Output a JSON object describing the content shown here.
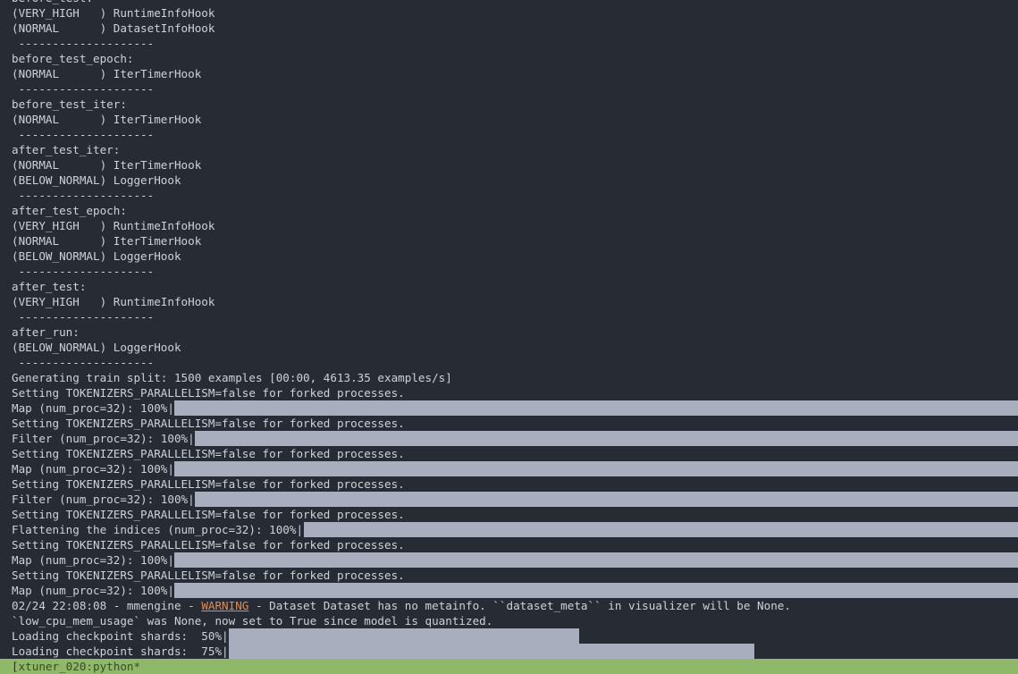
{
  "colors": {
    "background": "#272b33",
    "text": "#cdd2da",
    "progress": "#a9aebe",
    "warning": "#e98a45",
    "statusbar": "#8fb868"
  },
  "lines": [
    {
      "text": "before_test:"
    },
    {
      "text": "(VERY_HIGH   ) RuntimeInfoHook"
    },
    {
      "text": "(NORMAL      ) DatasetInfoHook"
    },
    {
      "text": " --------------------"
    },
    {
      "text": "before_test_epoch:"
    },
    {
      "text": "(NORMAL      ) IterTimerHook"
    },
    {
      "text": " --------------------"
    },
    {
      "text": "before_test_iter:"
    },
    {
      "text": "(NORMAL      ) IterTimerHook"
    },
    {
      "text": " --------------------"
    },
    {
      "text": "after_test_iter:"
    },
    {
      "text": "(NORMAL      ) IterTimerHook"
    },
    {
      "text": "(BELOW_NORMAL) LoggerHook"
    },
    {
      "text": " --------------------"
    },
    {
      "text": "after_test_epoch:"
    },
    {
      "text": "(VERY_HIGH   ) RuntimeInfoHook"
    },
    {
      "text": "(NORMAL      ) IterTimerHook"
    },
    {
      "text": "(BELOW_NORMAL) LoggerHook"
    },
    {
      "text": " --------------------"
    },
    {
      "text": "after_test:"
    },
    {
      "text": "(VERY_HIGH   ) RuntimeInfoHook"
    },
    {
      "text": " --------------------"
    },
    {
      "text": "after_run:"
    },
    {
      "text": "(BELOW_NORMAL) LoggerHook"
    },
    {
      "text": " --------------------"
    },
    {
      "text": "Generating train split: 1500 examples [00:00, 4613.35 examples/s]"
    },
    {
      "text": "Setting TOKENIZERS_PARALLELISM=false for forked processes."
    },
    {
      "text": "Map (num_proc=32): 100%",
      "progress": 1.0
    },
    {
      "text": "Setting TOKENIZERS_PARALLELISM=false for forked processes."
    },
    {
      "text": "Filter (num_proc=32): 100%",
      "progress": 1.0
    },
    {
      "text": "Setting TOKENIZERS_PARALLELISM=false for forked processes."
    },
    {
      "text": "Map (num_proc=32): 100%",
      "progress": 1.0
    },
    {
      "text": "Setting TOKENIZERS_PARALLELISM=false for forked processes."
    },
    {
      "text": "Filter (num_proc=32): 100%",
      "progress": 1.0
    },
    {
      "text": "Setting TOKENIZERS_PARALLELISM=false for forked processes."
    },
    {
      "text": "Flattening the indices (num_proc=32): 100%",
      "progress": 1.0
    },
    {
      "text": "Setting TOKENIZERS_PARALLELISM=false for forked processes."
    },
    {
      "text": "Map (num_proc=32): 100%",
      "progress": 1.0
    },
    {
      "text": "Setting TOKENIZERS_PARALLELISM=false for forked processes."
    },
    {
      "text": "Map (num_proc=32): 100%",
      "progress": 1.0
    },
    {
      "text": "02/24 22:08:08 - mmengine - ",
      "warning": "WARNING",
      "rest": " - Dataset Dataset has no metainfo. ``dataset_meta`` in visualizer will be None."
    },
    {
      "text": "`low_cpu_mem_usage` was None, now set to True since model is quantized."
    },
    {
      "text": "Loading checkpoint shards:  50%",
      "progress": 0.5
    },
    {
      "text": "Loading checkpoint shards:  75%",
      "progress": 0.75
    }
  ],
  "statusbar": {
    "bracket": "[",
    "label": "xtuner_020:python*"
  }
}
